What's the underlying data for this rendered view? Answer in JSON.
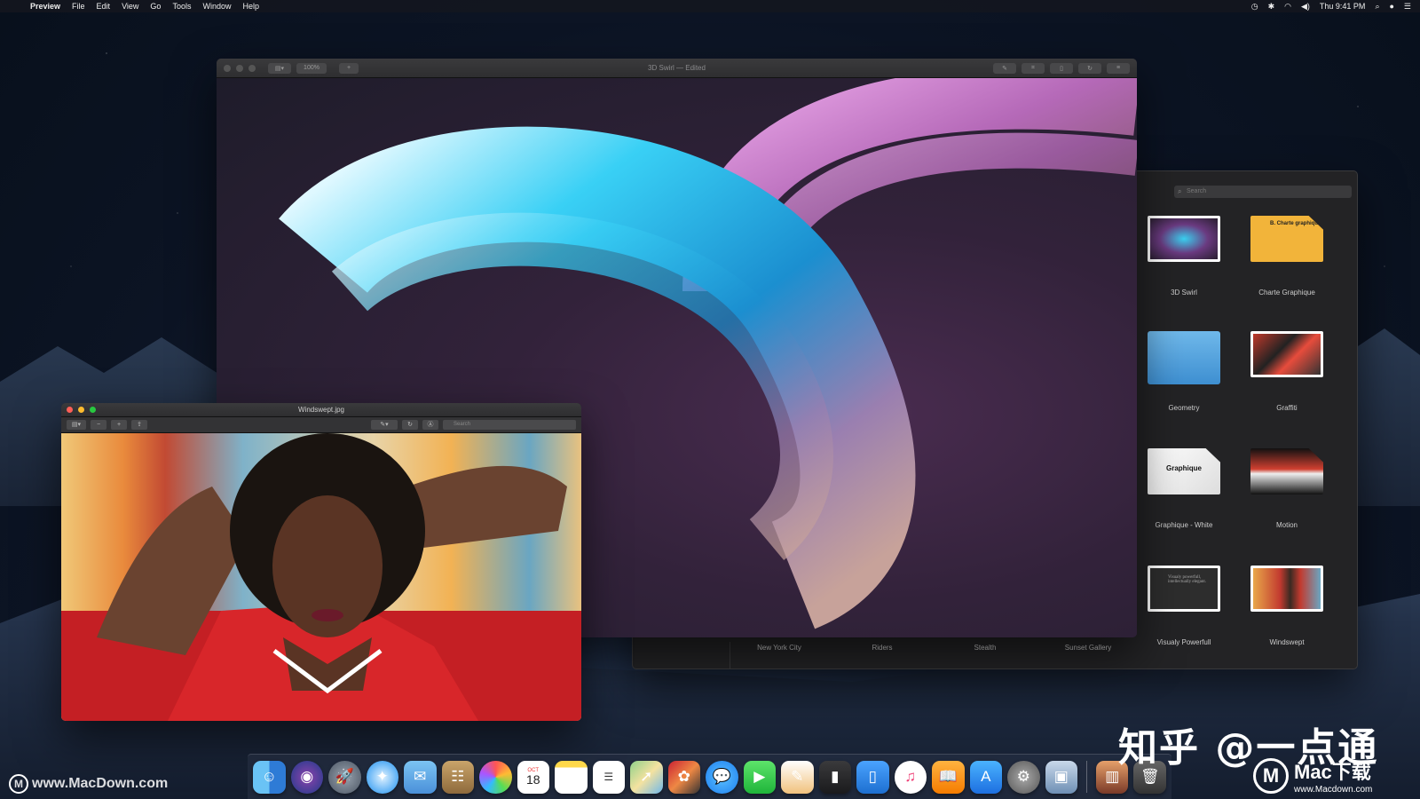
{
  "menubar": {
    "app_name": "Preview",
    "items": [
      "File",
      "Edit",
      "View",
      "Go",
      "Tools",
      "Window",
      "Help"
    ],
    "clock": "Thu 9:41 PM"
  },
  "main_window": {
    "title": "3D Swirl — Edited",
    "zoom_label": "100%"
  },
  "browser": {
    "search_placeholder": "Search",
    "grid_items": [
      {
        "label": "3D Swirl"
      },
      {
        "label": "Charte Graphique",
        "thumb_text": "B. Charte graphique"
      },
      {
        "label": "Geometry"
      },
      {
        "label": "Graffiti"
      },
      {
        "label": "Graphique - White",
        "thumb_text": "Graphique"
      },
      {
        "label": "Motion"
      },
      {
        "label": "Visualy Powerfull",
        "thumb_text": "Visualy powerfull, intellectually elegant."
      },
      {
        "label": "Windswept"
      }
    ],
    "bottom_labels": [
      "New York City",
      "Riders",
      "Stealth",
      "Sunset Gallery"
    ]
  },
  "small_window": {
    "title": "Windswept.jpg",
    "search_placeholder": "Search"
  },
  "dock": {
    "icons": [
      "finder-icon",
      "siri-icon",
      "launchpad-icon",
      "safari-icon",
      "mail-icon",
      "contacts-icon",
      "photos-icon",
      "calendar-icon",
      "notes-icon",
      "reminders-icon",
      "maps-icon",
      "photo-booth-icon",
      "messages-icon",
      "facetime-icon",
      "pages-icon",
      "numbers-icon",
      "keynote-icon",
      "itunes-icon",
      "books-icon",
      "app-store-icon",
      "system-preferences-icon",
      "preview-icon",
      "downloads-icon",
      "trash-icon"
    ],
    "calendar_day": "18",
    "calendar_month": "OCT"
  },
  "watermark": {
    "left": "www.MacDown.com",
    "zh": "知乎 @一点通",
    "right_title": "Mac下载",
    "right_url": "www.Macdown.com"
  }
}
